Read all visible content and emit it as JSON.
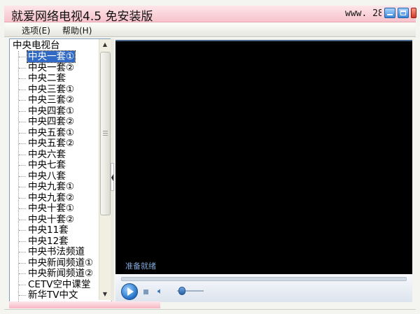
{
  "window": {
    "title": "就爱网络电视4.5 免安装版",
    "url_fragment": "www. 28",
    "controls": [
      "minimize-icon",
      "maximize-icon",
      "close-icon"
    ]
  },
  "menu": {
    "options_label": "选项(E)",
    "help_label": "帮助(H)"
  },
  "channel_tree": {
    "root_label": "中央电视台",
    "selected_index": 0,
    "items": [
      "中央一套①",
      "中央一套②",
      "中央二套",
      "中央三套①",
      "中央三套②",
      "中央四套①",
      "中央四套②",
      "中央五套①",
      "中央五套②",
      "中央六套",
      "中央七套",
      "中央八套",
      "中央九套①",
      "中央九套②",
      "中央十套①",
      "中央十套②",
      "中央11套",
      "中央12套",
      "中央书法频道",
      "中央新闻频道①",
      "中央新闻频道②",
      "CETV空中课堂",
      "新华TV中文"
    ]
  },
  "player": {
    "status_text": "准备就绪",
    "play_icon": "play-icon",
    "stop_icon": "stop-icon",
    "volume_icon": "speaker-icon",
    "volume_level": 0.15
  },
  "colors": {
    "title_bar": "#f7c3cc",
    "selection": "#316ac5",
    "video_bg": "#000000",
    "status_text": "#7fa8d8"
  }
}
